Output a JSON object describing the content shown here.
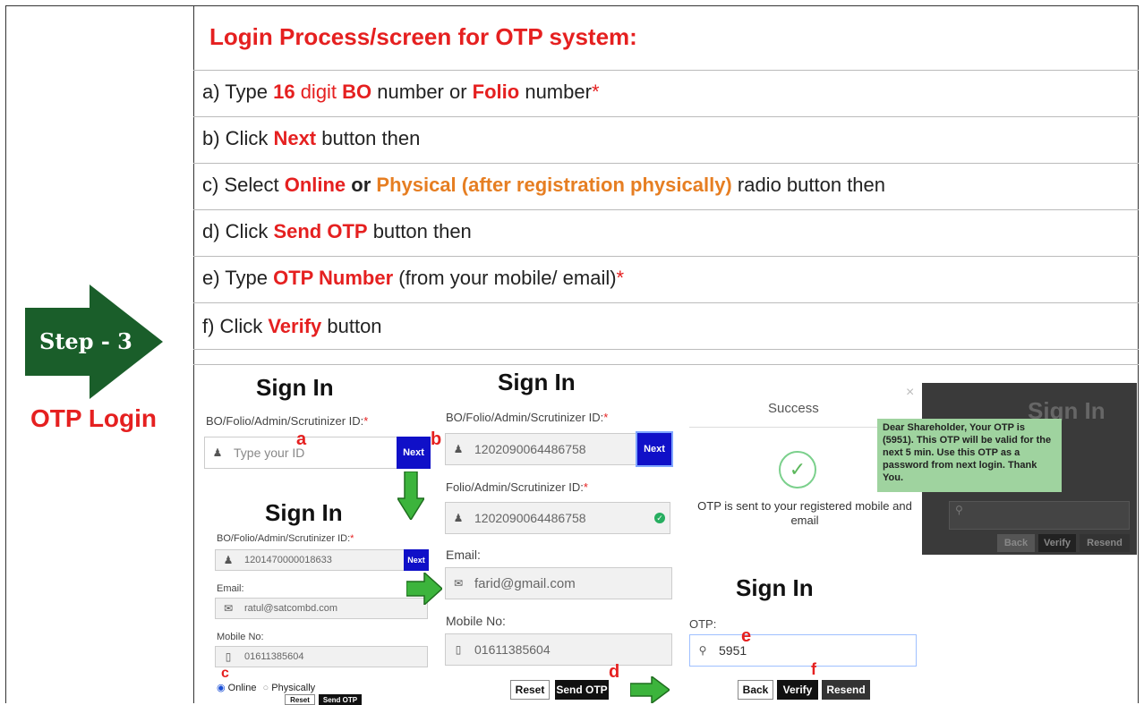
{
  "step_badge": "Step - 3",
  "left_label": "OTP Login",
  "title": "Login Process/screen for OTP system:",
  "instructions": {
    "a": {
      "prefix": "a) Type ",
      "num": "16",
      "mid": " digit ",
      "bo": "BO",
      "mid2": " number or ",
      "folio": "Folio",
      "suffix": " number",
      "star": "*"
    },
    "b": {
      "prefix": "b) Click ",
      "key": "Next",
      "suffix": " button then"
    },
    "c": {
      "prefix": "c) Select ",
      "online": "Online",
      "or": " or ",
      "physical": "Physical (after registration physically)",
      "suffix": " radio button then"
    },
    "d": {
      "prefix": "d) Click ",
      "key": "Send OTP",
      "suffix": " button then"
    },
    "e": {
      "prefix": "e) Type ",
      "key": "OTP Number",
      "suffix": " (from your mobile/ email)",
      "star": "*"
    },
    "f": {
      "prefix": "f)  Click ",
      "key": "Verify",
      "suffix": " button"
    }
  },
  "screen1": {
    "heading": "Sign In",
    "id_label": "BO/Folio/Admin/Scrutinizer ID:",
    "star": "*",
    "placeholder": "Type your ID",
    "next": "Next",
    "marker_a": "a",
    "marker_b": "b"
  },
  "screen2": {
    "heading": "Sign In",
    "id_label": "BO/Folio/Admin/Scrutinizer ID:",
    "star": "*",
    "id_value": "1202090064486758",
    "next": "Next",
    "folio_label": "Folio/Admin/Scrutinizer ID:",
    "folio_value": "1202090064486758",
    "email_label": "Email:",
    "email_value": "farid@gmail.com",
    "mobile_label": "Mobile No:",
    "mobile_value": "01611385604",
    "reset": "Reset",
    "send_otp": "Send OTP",
    "marker_d": "d"
  },
  "screen3": {
    "heading": "Sign In",
    "id_label": "BO/Folio/Admin/Scrutinizer ID:",
    "star": "*",
    "id_value": "1201470000018633",
    "next": "Next",
    "email_label": "Email:",
    "email_value": "ratul@satcombd.com",
    "mobile_label": "Mobile No:",
    "mobile_value": "01611385604",
    "online": "Online",
    "physically": "Physically",
    "reset": "Reset",
    "send_otp": "Send OTP",
    "marker_c": "c"
  },
  "success_modal": {
    "title": "Success",
    "close": "×",
    "message": "OTP is sent to your registered mobile and email",
    "toast": "Dear Shareholder, Your OTP is (5951). This OTP will be valid for the next 5 min. Use this OTP as a password from next login. Thank You.",
    "bg_heading": "Sign In",
    "bg_back": "Back",
    "bg_verify": "Verify",
    "bg_resend": "Resend"
  },
  "screen4": {
    "heading": "Sign In",
    "otp_label": "OTP:",
    "otp_value": "5951",
    "back": "Back",
    "verify": "Verify",
    "resend": "Resend",
    "marker_e": "e",
    "marker_f": "f"
  },
  "colors": {
    "red": "#e52020",
    "orange": "#e67e22",
    "green_arrow": "#1f8a1f",
    "next_blue": "#1010c8",
    "step_badge_green": "#1a5e2a"
  }
}
